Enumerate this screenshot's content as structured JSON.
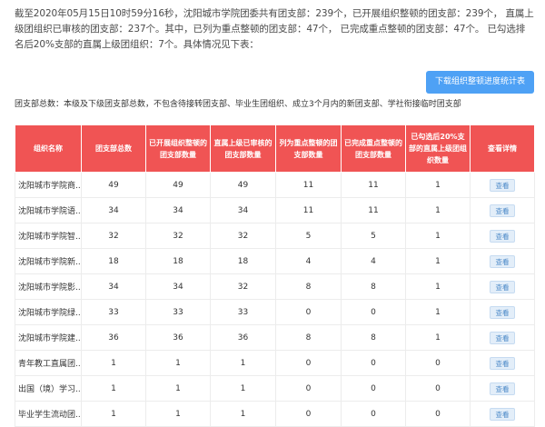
{
  "summary": "截至2020年05月15日10时59分16秒，沈阳城市学院团委共有团支部：239个，已开展组织整顿的团支部：239个， 直属上级团组织已审核的团支部：237个。其中，已列为重点整顿的团支部：47个， 已完成重点整顿的团支部：47个。 已勾选排名后20%支部的直属上级团组织：7个。具体情况见下表：",
  "download_button": "下载组织整顿进度统计表",
  "note": "团支部总数：本级及下级团支部总数，不包含待接转团支部、毕业生团组织、成立3个月内的新团支部、学社衔接临时团支部",
  "table": {
    "headers": [
      "组织名称",
      "团支部总数",
      "已开展组织整顿的团支部数量",
      "直属上级已审核的团支部数量",
      "列为重点整顿的团支部数量",
      "已完成重点整顿的团支部数量",
      "已勾选后20%支部的直属上级团组织数量",
      "查看详情"
    ],
    "view_label": "查看",
    "rows": [
      {
        "name": "沈阳城市学院商...",
        "total": "49",
        "started": "49",
        "reviewed": "49",
        "key": "11",
        "done": "11",
        "bottom": "1"
      },
      {
        "name": "沈阳城市学院语...",
        "total": "34",
        "started": "34",
        "reviewed": "34",
        "key": "11",
        "done": "11",
        "bottom": "1"
      },
      {
        "name": "沈阳城市学院智...",
        "total": "32",
        "started": "32",
        "reviewed": "32",
        "key": "5",
        "done": "5",
        "bottom": "1"
      },
      {
        "name": "沈阳城市学院新...",
        "total": "18",
        "started": "18",
        "reviewed": "18",
        "key": "4",
        "done": "4",
        "bottom": "1"
      },
      {
        "name": "沈阳城市学院影...",
        "total": "34",
        "started": "34",
        "reviewed": "32",
        "key": "8",
        "done": "8",
        "bottom": "1"
      },
      {
        "name": "沈阳城市学院绿...",
        "total": "33",
        "started": "33",
        "reviewed": "33",
        "key": "0",
        "done": "0",
        "bottom": "1"
      },
      {
        "name": "沈阳城市学院建...",
        "total": "36",
        "started": "36",
        "reviewed": "36",
        "key": "8",
        "done": "8",
        "bottom": "1"
      },
      {
        "name": "青年教工直属团...",
        "total": "1",
        "started": "1",
        "reviewed": "1",
        "key": "0",
        "done": "0",
        "bottom": "0"
      },
      {
        "name": "出国（境）学习...",
        "total": "1",
        "started": "1",
        "reviewed": "1",
        "key": "0",
        "done": "0",
        "bottom": "0"
      },
      {
        "name": "毕业学生流动团...",
        "total": "1",
        "started": "1",
        "reviewed": "1",
        "key": "0",
        "done": "0",
        "bottom": "0"
      }
    ]
  }
}
